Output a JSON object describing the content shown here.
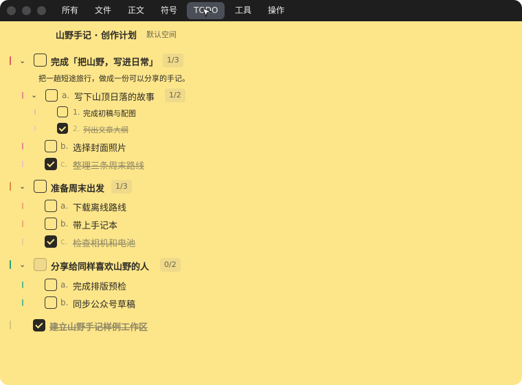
{
  "menu": {
    "items": [
      "所有",
      "文件",
      "正文",
      "符号",
      "TODO",
      "工具",
      "操作"
    ],
    "active_index": 4
  },
  "doc": {
    "title": "山野手记 · 创作计划",
    "space": "默认空间"
  },
  "tasks": [
    {
      "label": "完成「把山野，写进日常」",
      "count": "1/3",
      "checked": false,
      "description": "把一趟短途旅行，做成一份可以分享的手记。",
      "subtasks": [
        {
          "prefix": "a.",
          "label": "写下山顶日落的故事",
          "count": "1/2",
          "checked": false,
          "items": [
            {
              "prefix": "1.",
              "label": "完成初稿与配图",
              "checked": false
            },
            {
              "prefix": "2.",
              "label": "列出文章大纲",
              "checked": true
            }
          ]
        },
        {
          "prefix": "b.",
          "label": "选择封面照片",
          "checked": false
        },
        {
          "prefix": "c.",
          "label": "整理三条周末路线",
          "checked": true
        }
      ]
    },
    {
      "label": "准备周末出发",
      "count": "1/3",
      "checked": false,
      "subtasks": [
        {
          "prefix": "a.",
          "label": "下载离线路线",
          "checked": false
        },
        {
          "prefix": "b.",
          "label": "带上手记本",
          "checked": false
        },
        {
          "prefix": "c.",
          "label": "检查相机和电池",
          "checked": true
        }
      ]
    },
    {
      "label": "分享给同样喜欢山野的人",
      "count": "0/2",
      "checked": false,
      "subtasks": [
        {
          "prefix": "a.",
          "label": "完成排版预检",
          "checked": false
        },
        {
          "prefix": "b.",
          "label": "同步公众号草稿",
          "checked": false
        }
      ]
    },
    {
      "label": "建立山野手记样例工作区",
      "checked": true
    }
  ],
  "colors": {
    "background": "#fde68a",
    "titlebar": "#1e1e1f",
    "task1_bar": "#e25b5b",
    "task2_bar": "#e08a3c",
    "task3_bar": "#2f9e6e",
    "task4_bar": "#d9c27a"
  }
}
